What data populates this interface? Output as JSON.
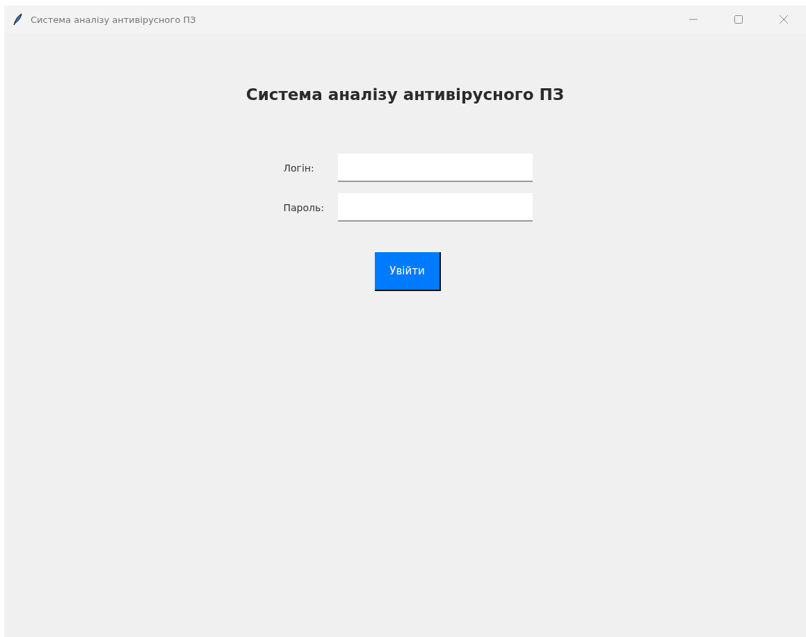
{
  "window": {
    "title": "Система аналізу антивірусного ПЗ"
  },
  "heading": "Система аналізу антивірусного ПЗ",
  "fields": [
    {
      "label": "Логін:"
    },
    {
      "label": "Пароль:"
    }
  ],
  "login_button": "Увійти"
}
